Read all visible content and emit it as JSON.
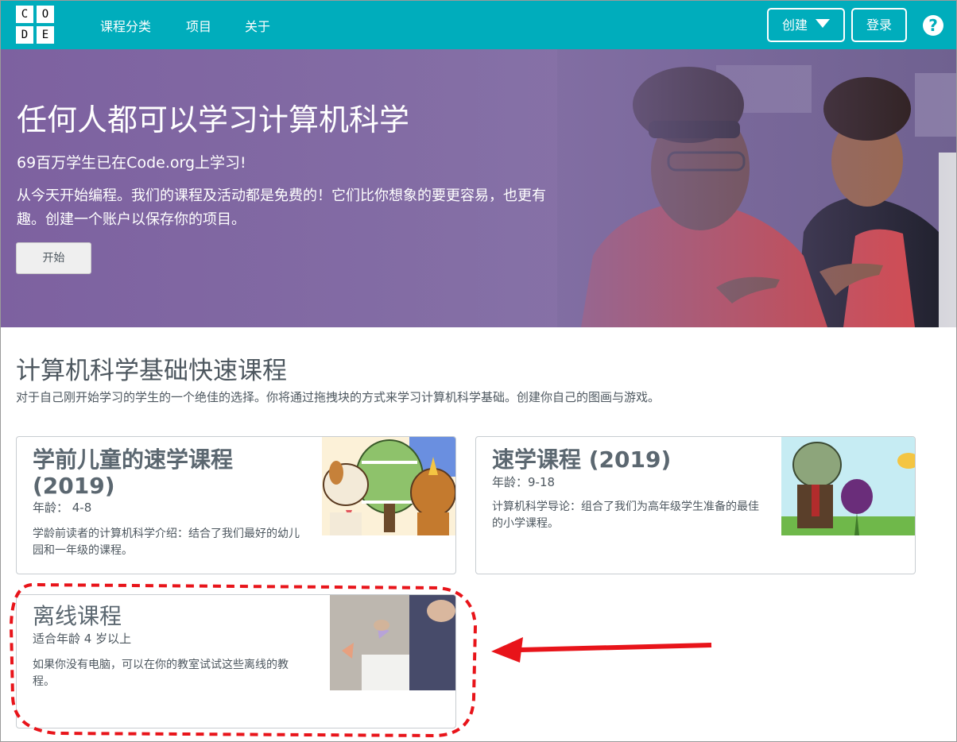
{
  "header": {
    "logo_letters": [
      "C",
      "O",
      "D",
      "E"
    ],
    "nav": [
      "课程分类",
      "项目",
      "关于"
    ],
    "create_label": "创建",
    "login_label": "登录",
    "help_glyph": "?"
  },
  "hero": {
    "title": "任何人都可以学习计算机科学",
    "stat": "69百万学生已在Code.org上学习!",
    "body": "从今天开始编程。我们的课程及活动都是免费的！它们比你想象的要更容易，也更有趣。创建一个账户以保存你的项目。",
    "button": "开始"
  },
  "section": {
    "title": "计算机科学基础快速课程",
    "description": "对于自己刚开始学习的学生的一个绝佳的选择。你将通过拖拽块的方式来学习计算机科学基础。创建你自己的图画与游戏。"
  },
  "cards": [
    {
      "title": "学前儿童的速学课程 (2019)",
      "age": "年龄： 4-8",
      "description": "学龄前读者的计算机科学介绍：结合了我们最好的幼儿园和一年级的课程。"
    },
    {
      "title": "速学课程 (2019)",
      "age": "年龄：9-18",
      "description": "计算机科学导论：组合了我们为高年级学生准备的最佳的小学课程。"
    },
    {
      "title": "离线课程",
      "age": "适合年龄 4 岁以上",
      "description": "如果你没有电脑，可以在你的教室试试这些离线的教程。"
    }
  ],
  "colors": {
    "header_bg": "#00adbc",
    "hero_bg": "#7f669f",
    "annotation_red": "#e8141a"
  },
  "icons": [
    "caret-down-icon",
    "help-icon",
    "arrow-annotation-icon"
  ]
}
